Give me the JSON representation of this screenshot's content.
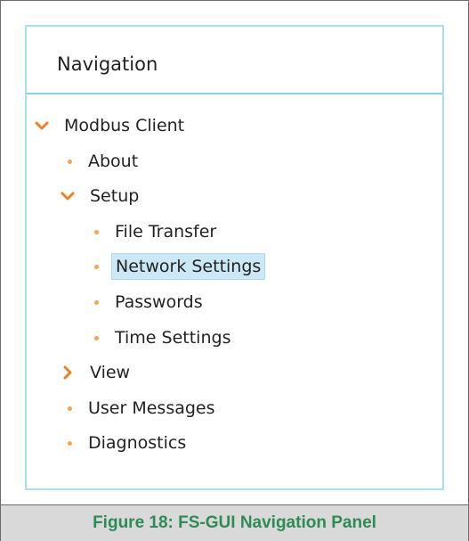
{
  "panel": {
    "title": "Navigation"
  },
  "tree": [
    {
      "label": "Modbus Client",
      "icon": "chevron-down-icon"
    },
    {
      "label": "About",
      "icon": "bullet-icon"
    },
    {
      "label": "Setup",
      "icon": "chevron-down-icon"
    },
    {
      "label": "File Transfer",
      "icon": "bullet-icon"
    },
    {
      "label": "Network Settings",
      "icon": "bullet-icon",
      "selected": true
    },
    {
      "label": "Passwords",
      "icon": "bullet-icon"
    },
    {
      "label": "Time Settings",
      "icon": "bullet-icon"
    },
    {
      "label": "View",
      "icon": "chevron-right-icon"
    },
    {
      "label": "User Messages",
      "icon": "bullet-icon"
    },
    {
      "label": "Diagnostics",
      "icon": "bullet-icon"
    }
  ],
  "caption": "Figure 18: FS-GUI Navigation Panel",
  "colors": {
    "accent_orange": "#f5a54a",
    "panel_border": "#a9dff0",
    "selection_bg": "#cce8f7",
    "caption_green": "#2e8b57"
  }
}
